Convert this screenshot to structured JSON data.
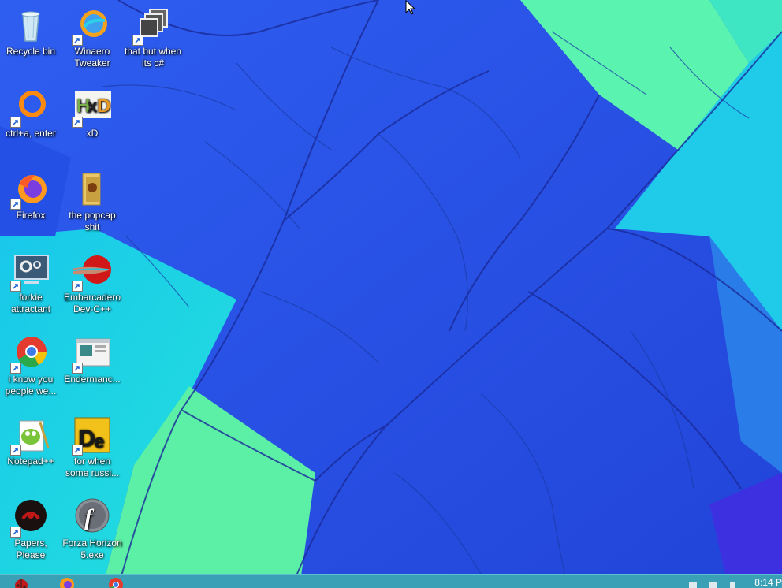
{
  "desktop": {
    "icons": [
      {
        "label": "Recycle bin",
        "icon": "recycle-bin-icon"
      },
      {
        "label": "Winaero Tweaker",
        "icon": "winaero-tweaker-icon"
      },
      {
        "label": "that but when its c#",
        "icon": "windows-stack-icon"
      },
      {
        "label": "ctrl+a, enter",
        "icon": "orange-ring-icon"
      },
      {
        "label": "xD",
        "icon": "hxd-icon"
      },
      {
        "label": "Firefox",
        "icon": "firefox-icon"
      },
      {
        "label": "the popcap shit",
        "icon": "folder-icon"
      },
      {
        "label": "forkie attractant",
        "icon": "settings-monitor-icon"
      },
      {
        "label": "Embarcadero Dev-C++",
        "icon": "fish-icon"
      },
      {
        "label": "i know you people we...",
        "icon": "chrome-icon"
      },
      {
        "label": "Endermanc...",
        "icon": "window-app-icon"
      },
      {
        "label": "Notepad++",
        "icon": "notepad-plus-plus-icon"
      },
      {
        "label": "for when some russi...",
        "icon": "de-icon"
      },
      {
        "label": "Papers, Please",
        "icon": "papers-please-icon"
      },
      {
        "label": "Forza Horizon 5.exe",
        "icon": "flash-icon"
      }
    ]
  },
  "taskbar": {
    "clock": "8:14 P",
    "pinned": [
      "ladybug-icon",
      "firefox-icon",
      "chrome-icon"
    ]
  },
  "colors": {
    "wallpaper_blue": "#2a4fe0",
    "wallpaper_cyan": "#18d6e6",
    "wallpaper_green": "#55f0a8",
    "taskbar": "#3aa0b5"
  }
}
